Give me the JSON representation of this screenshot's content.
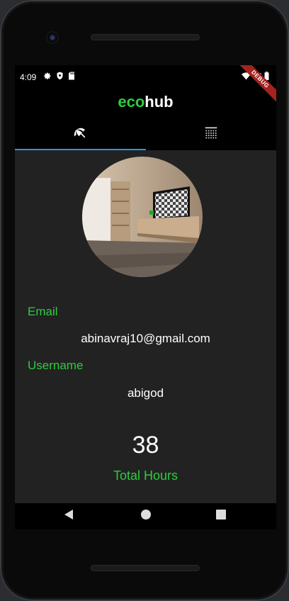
{
  "status": {
    "time": "4:09",
    "debug": "DEBUG"
  },
  "app": {
    "brand_part1": "eco",
    "brand_part2": "hub",
    "brand_color": "#2ecc40",
    "tab_indicator_color": "#2196f3"
  },
  "tabs": [
    {
      "icon": "beach-umbrella-icon",
      "active": true
    },
    {
      "icon": "grid-calendar-icon",
      "active": false
    }
  ],
  "profile": {
    "email_label": "Email",
    "email": "abinavraj10@gmail.com",
    "username_label": "Username",
    "username": "abigod",
    "total_hours": "38",
    "total_hours_label": "Total Hours"
  },
  "navbar": {
    "icons": [
      "back-icon",
      "home-icon",
      "recents-icon"
    ]
  }
}
